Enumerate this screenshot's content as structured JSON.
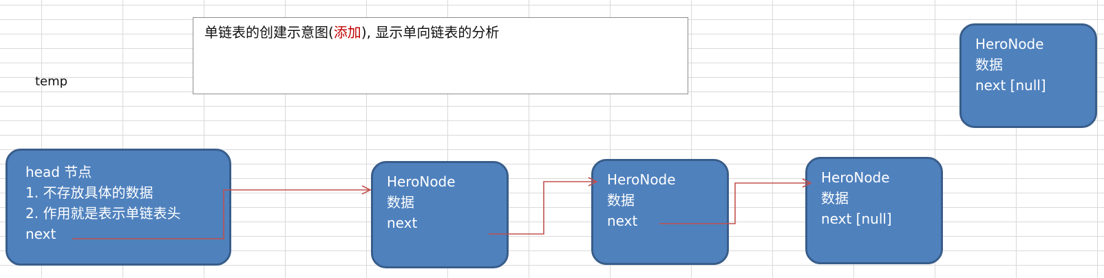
{
  "title": {
    "before": "单链表的创建示意图(",
    "highlight": "添加",
    "after": "), 显示单向链表的分析"
  },
  "temp_label": "temp",
  "nodes": [
    {
      "id": "head",
      "lines": [
        "head 节点",
        "1. 不存放具体的数据",
        "2. 作用就是表示单链表头",
        "next"
      ]
    },
    {
      "id": "node-1",
      "lines": [
        "HeroNode",
        "数据",
        "next"
      ]
    },
    {
      "id": "node-2",
      "lines": [
        "HeroNode",
        "数据",
        "next"
      ]
    },
    {
      "id": "node-3",
      "lines": [
        "HeroNode",
        "数据",
        "next [null]"
      ]
    },
    {
      "id": "node-4",
      "lines": [
        "HeroNode",
        "数据",
        "next [null]"
      ]
    }
  ],
  "colors": {
    "node_fill": "#4f81bd",
    "node_border": "#385d8a",
    "arrow": "#c0504d",
    "highlight_text": "#c00000",
    "grid": "#d9d9d9"
  }
}
